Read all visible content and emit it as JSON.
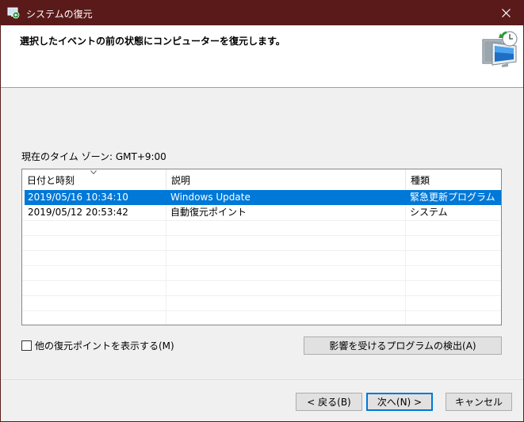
{
  "window": {
    "title": "システムの復元",
    "close_icon": "close-icon",
    "app_icon": "system-restore-icon",
    "titlebar_color": "#5a1a1a"
  },
  "header": {
    "heading": "選択したイベントの前の状態にコンピューターを復元します。",
    "hero_icon": "restore-computer-clock-icon"
  },
  "timezone_label": "現在のタイム ゾーン: GMT+9:00",
  "table": {
    "columns": [
      "日付と時刻",
      "説明",
      "種類"
    ],
    "sort_icon": "sort-descending-icon",
    "rows": [
      {
        "date": "2019/05/16 10:34:10",
        "description": "Windows Update",
        "type": "緊急更新プログラム",
        "selected": true
      },
      {
        "date": "2019/05/12 20:53:42",
        "description": "自動復元ポイント",
        "type": "システム",
        "selected": false
      }
    ],
    "selection_color": "#0078d7"
  },
  "show_more_checkbox": {
    "label": "他の復元ポイントを表示する(M)",
    "checked": false
  },
  "buttons": {
    "scan": "影響を受けるプログラムの検出(A)",
    "back": "< 戻る(B)",
    "next": "次へ(N) >",
    "cancel": "キャンセル"
  }
}
